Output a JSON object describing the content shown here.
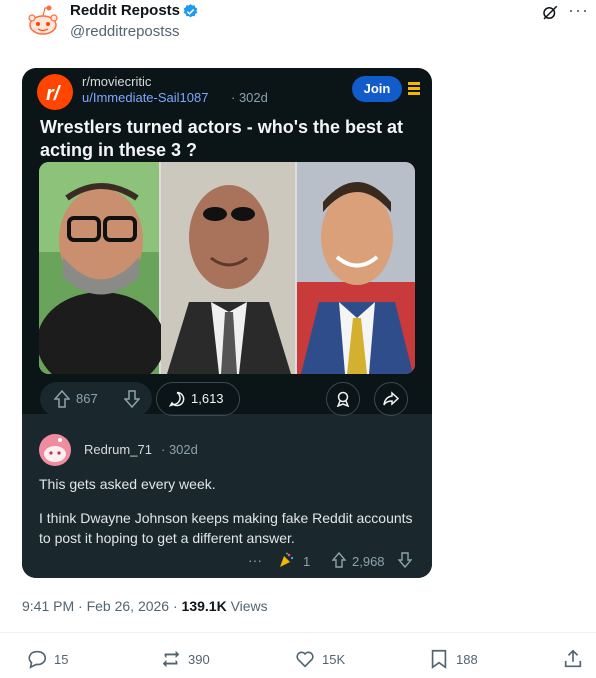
{
  "author": {
    "name": "Reddit Reposts",
    "handle": "@redditrepostss"
  },
  "post": {
    "subreddit": "r/moviecritic",
    "user": "u/Immediate-Sail1087",
    "age": "· 302d",
    "join_label": "Join",
    "title": "Wrestlers turned actors - who's the best at acting in these 3 ?",
    "upvotes": "867",
    "comments": "1,613"
  },
  "comment": {
    "user": "Redrum_71",
    "age": "· 302d",
    "text1": "This gets asked every week.",
    "text2": "I think Dwayne Johnson keeps making fake Reddit accounts to post it hoping to get a different answer.",
    "more": "···",
    "awards": "1",
    "votes": "2,968"
  },
  "meta": {
    "time_date": "9:41 PM · Feb 26, 2026 · ",
    "views_count": "139.1K",
    "views_label": " Views"
  },
  "actions": {
    "replies": "15",
    "reposts": "390",
    "likes": "15K",
    "bookmarks": "188"
  },
  "colors": {
    "reddit_orange": "#ff4500",
    "card_bg": "#0b1416",
    "join_blue": "#115bca",
    "verified_blue": "#1d9bf0"
  }
}
